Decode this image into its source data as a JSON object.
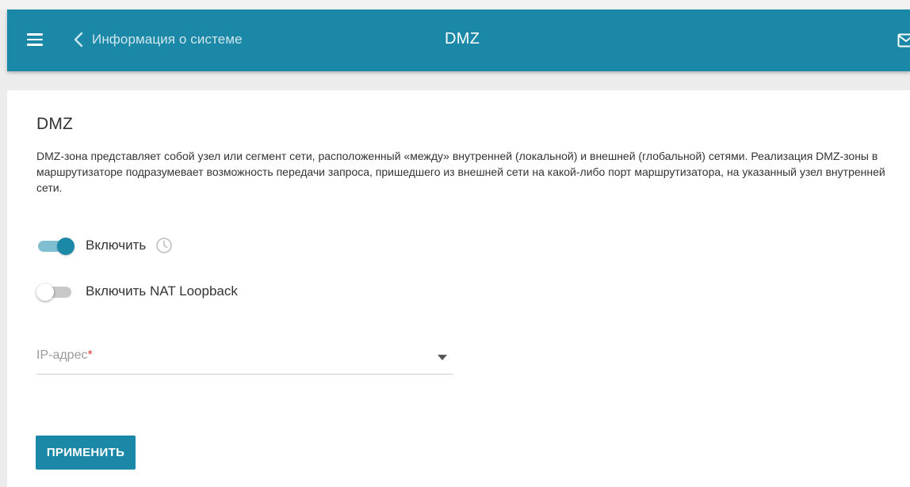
{
  "header": {
    "back_label": "Информация о системе",
    "title": "DMZ",
    "menu_icon": "hamburger-menu-icon",
    "back_icon": "chevron-left-icon",
    "notifications_icon": "mail-icon"
  },
  "section": {
    "title": "DMZ",
    "description": "DMZ-зона представляет собой узел или сегмент сети, расположенный «между» внутренней (локальной) и внешней (глобальной) сетями. Реализация DMZ-зоны в маршрутизаторе подразумевает возможность передачи запроса, пришедшего из внешней сети на какой-либо порт маршрутизатора, на указанный узел внутренней сети."
  },
  "form": {
    "enable_toggle": {
      "label": "Включить",
      "state": "on",
      "extra_icon": "clock-icon"
    },
    "nat_loopback_toggle": {
      "label": "Включить NAT Loopback",
      "state": "off"
    },
    "ip_select": {
      "label": "IP-адрес",
      "required_mark": "*",
      "value": "",
      "icon": "dropdown-arrow-icon"
    },
    "apply_button": "ПРИМЕНИТЬ"
  },
  "colors": {
    "primary": "#1a88a6",
    "toggle_track_on": "#7fbfd1",
    "background": "#ececec",
    "panel": "#ffffff",
    "text": "#333333",
    "required": "#e03b3b"
  }
}
